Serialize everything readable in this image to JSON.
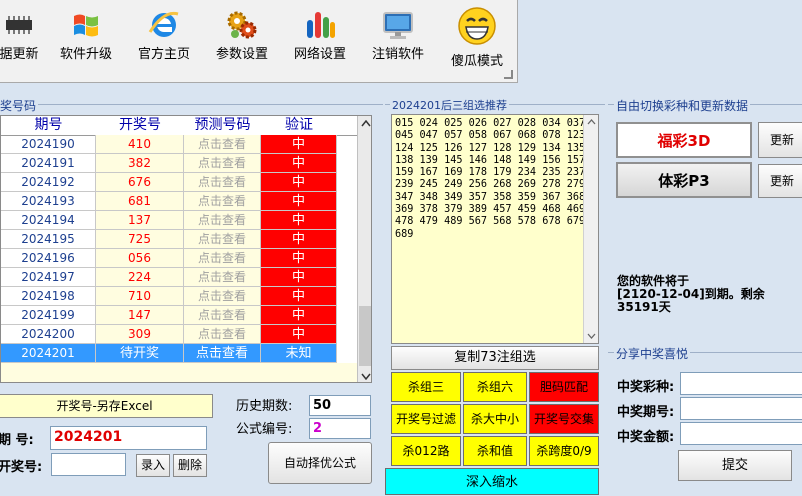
{
  "toolbar": {
    "buttons": [
      {
        "label": "据更新",
        "icon": "chip-icon"
      },
      {
        "label": "软件升级",
        "icon": "windows-logo-icon"
      },
      {
        "label": "官方主页",
        "icon": "internet-explorer-icon"
      },
      {
        "label": "参数设置",
        "icon": "gears-icon"
      },
      {
        "label": "网络设置",
        "icon": "network-bars-icon"
      },
      {
        "label": "注销软件",
        "icon": "monitor-icon"
      },
      {
        "label": "傻瓜模式",
        "icon": "smiley-icon"
      }
    ]
  },
  "left_group": {
    "title": "奖号码"
  },
  "table": {
    "headers": [
      "期号",
      "开奖号",
      "预测号码",
      "验证"
    ],
    "rows": [
      {
        "period": "2024190",
        "draw": "410",
        "pred": "点击查看",
        "verify": "中"
      },
      {
        "period": "2024191",
        "draw": "382",
        "pred": "点击查看",
        "verify": "中"
      },
      {
        "period": "2024192",
        "draw": "676",
        "pred": "点击查看",
        "verify": "中"
      },
      {
        "period": "2024193",
        "draw": "681",
        "pred": "点击查看",
        "verify": "中"
      },
      {
        "period": "2024194",
        "draw": "137",
        "pred": "点击查看",
        "verify": "中"
      },
      {
        "period": "2024195",
        "draw": "725",
        "pred": "点击查看",
        "verify": "中"
      },
      {
        "period": "2024196",
        "draw": "056",
        "pred": "点击查看",
        "verify": "中"
      },
      {
        "period": "2024197",
        "draw": "224",
        "pred": "点击查看",
        "verify": "中"
      },
      {
        "period": "2024198",
        "draw": "710",
        "pred": "点击查看",
        "verify": "中"
      },
      {
        "period": "2024199",
        "draw": "147",
        "pred": "点击查看",
        "verify": "中"
      },
      {
        "period": "2024200",
        "draw": "309",
        "pred": "点击查看",
        "verify": "中"
      },
      {
        "period": "2024201",
        "draw": "待开奖",
        "pred": "点击查看",
        "verify": "未知"
      }
    ]
  },
  "bottom_left": {
    "excel_button": "开奖号-另存Excel",
    "history_label": "历史期数:",
    "history_value": "50",
    "formula_label": "公式编号:",
    "formula_value": "2",
    "period_label": "期  号:",
    "period_value": "2024201",
    "draw_label": "开奖号:",
    "draw_value": "",
    "enter_button": "录入",
    "delete_button": "删除",
    "auto_button": "自动择优公式"
  },
  "middle": {
    "title": "2024201后三组选推荐",
    "numbers": "015 024 025 026 027 028 034 037\n045 047 057 058 067 068 078 123\n124 125 126 127 128 129 134 135\n138 139 145 146 148 149 156 157\n159 167 169 178 179 234 235 237\n239 245 249 256 268 269 278 279\n347 348 349 357 358 359 367 368\n369 378 379 389 457 459 468 469\n478 479 489 567 568 578 678 679\n689",
    "copy_button": "复制73注组选",
    "filters": [
      {
        "label": "杀组三",
        "red": false
      },
      {
        "label": "杀组六",
        "red": false
      },
      {
        "label": "胆码匹配",
        "red": true
      },
      {
        "label": "开奖号过滤",
        "red": false
      },
      {
        "label": "杀大中小",
        "red": false
      },
      {
        "label": "开奖号交集",
        "red": true
      },
      {
        "label": "杀012路",
        "red": false
      },
      {
        "label": "杀和值",
        "red": false
      },
      {
        "label": "杀跨度0/9",
        "red": false
      }
    ],
    "shrink_button": "深入缩水"
  },
  "right_top": {
    "title": "自由切换彩种和更新数据",
    "fc3d": "福彩3D",
    "tcp3": "体彩P3",
    "update_label": "更新",
    "expiry_line1": "您的软件将于",
    "expiry_line2": "[2120-12-04]到期。剩余",
    "expiry_line3": "35191天"
  },
  "right_bottom": {
    "title": "分享中奖喜悦",
    "lottery_label": "中奖彩种:",
    "period_label": "中奖期号:",
    "amount_label": "中奖金额:",
    "submit_button": "提交"
  },
  "colors": {
    "hit_red": "#ff0000",
    "pending_blue": "#3399ff",
    "filter_yellow": "#ffff00",
    "shrink_cyan": "#00ffff",
    "panel_bg": "#d9e4f1"
  }
}
